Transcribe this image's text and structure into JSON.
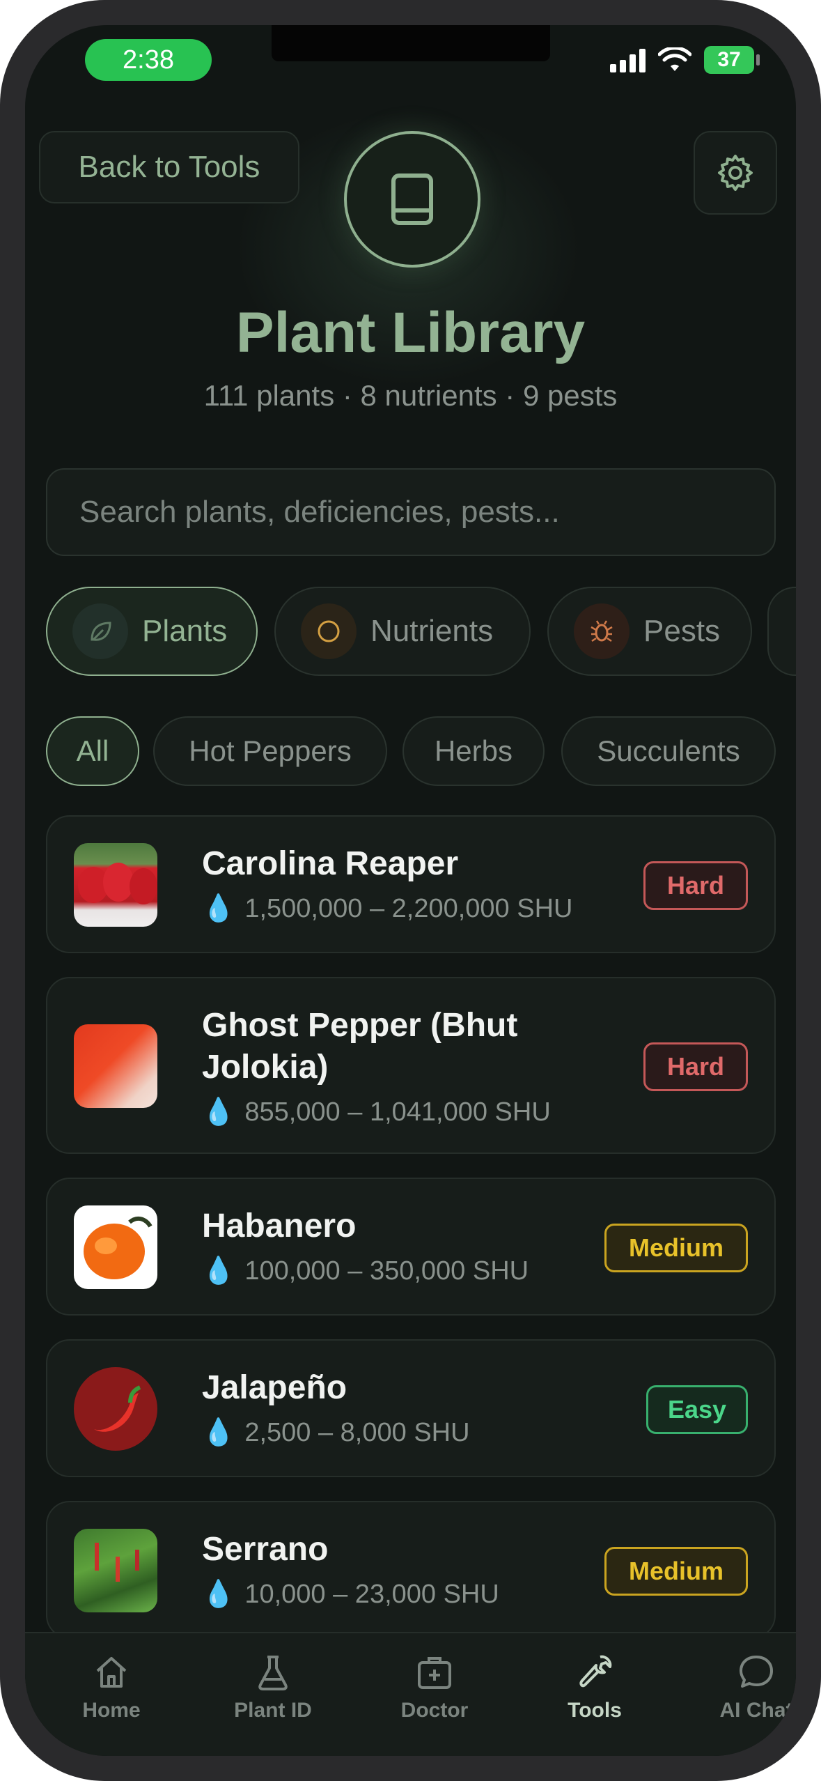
{
  "status": {
    "time": "2:38",
    "battery": "37"
  },
  "header": {
    "back_label": "Back to Tools",
    "title": "Plant Library",
    "subtitle": "111 plants · 8 nutrients · 9 pests"
  },
  "search": {
    "placeholder": "Search plants, deficiencies, pests..."
  },
  "tabs": [
    {
      "label": "Plants",
      "icon": "leaf-icon"
    },
    {
      "label": "Nutrients",
      "icon": "circle-icon"
    },
    {
      "label": "Pests",
      "icon": "bug-icon"
    }
  ],
  "filters": [
    "All",
    "Hot Peppers",
    "Herbs",
    "Succulents"
  ],
  "plants": [
    {
      "name": "Carolina Reaper",
      "shu": "1,500,000 – 2,200,000 SHU",
      "difficulty": "Hard"
    },
    {
      "name": "Ghost Pepper (Bhut Jolokia)",
      "name_line1": "Ghost Pepper (Bhut",
      "name_line2": "Jolokia)",
      "shu": "855,000 – 1,041,000 SHU",
      "difficulty": "Hard"
    },
    {
      "name": "Habanero",
      "shu": "100,000 – 350,000 SHU",
      "difficulty": "Medium"
    },
    {
      "name": "Jalapeño",
      "shu": "2,500 – 8,000 SHU",
      "difficulty": "Easy"
    },
    {
      "name": "Serrano",
      "shu": "10,000 – 23,000 SHU",
      "difficulty": "Medium"
    }
  ],
  "nav": [
    {
      "label": "Home",
      "icon": "home-icon"
    },
    {
      "label": "Plant ID",
      "icon": "flask-icon"
    },
    {
      "label": "Doctor",
      "icon": "medkit-icon"
    },
    {
      "label": "Tools",
      "icon": "wrench-icon"
    },
    {
      "label": "AI Chat",
      "icon": "chat-icon"
    }
  ],
  "colors": {
    "accent": "#93b393",
    "background": "#111614",
    "hard": "#e06a6a",
    "medium": "#e8c22a",
    "easy": "#4bd68a"
  }
}
